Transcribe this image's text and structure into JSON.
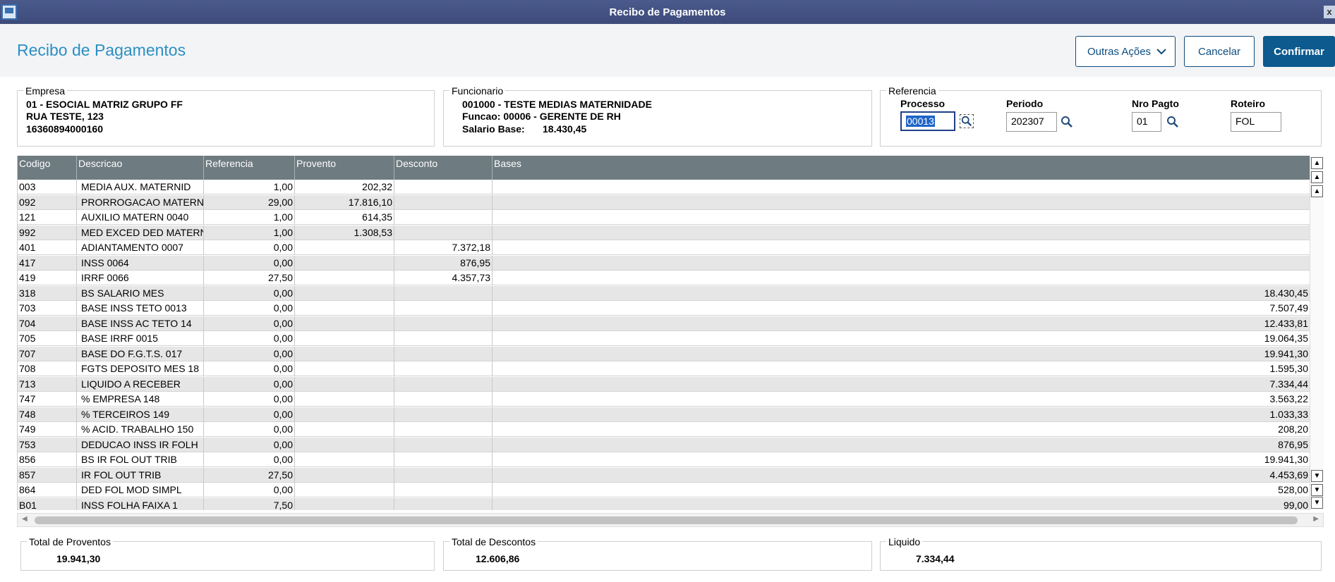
{
  "window": {
    "title": "Recibo de Pagamentos",
    "close": "x"
  },
  "header": {
    "title": "Recibo de Pagamentos",
    "outras_acoes": "Outras Ações",
    "cancelar": "Cancelar",
    "confirmar": "Confirmar"
  },
  "empresa": {
    "legend": "Empresa",
    "line1": "01 - ESOCIAL MATRIZ GRUPO FF",
    "line2": "RUA TESTE, 123",
    "line3": "16360894000160"
  },
  "funcionario": {
    "legend": "Funcionario",
    "line1": "001000 - TESTE MEDIAS MATERNIDADE",
    "line2": "Funcao: 00006 - GERENTE DE RH",
    "salario_label": "Salario Base:",
    "salario_value": "18.430,45"
  },
  "referencia": {
    "legend": "Referencia",
    "processo_label": "Processo",
    "processo_value": "00013",
    "periodo_label": "Periodo",
    "periodo_value": "202307",
    "nro_label": "Nro Pagto",
    "nro_value": "01",
    "roteiro_label": "Roteiro",
    "roteiro_value": "FOL"
  },
  "grid": {
    "columns": [
      "Codigo",
      "Descricao",
      "Referencia",
      "Provento",
      "Desconto",
      "Bases"
    ],
    "rows": [
      {
        "codigo": "003",
        "descricao": "MEDIA AUX. MATERNID",
        "referencia": "1,00",
        "provento": "202,32",
        "desconto": "",
        "bases": ""
      },
      {
        "codigo": "092",
        "descricao": "PRORROGACAO MATERN",
        "referencia": "29,00",
        "provento": "17.816,10",
        "desconto": "",
        "bases": ""
      },
      {
        "codigo": "121",
        "descricao": "AUXILIO MATERN 0040",
        "referencia": "1,00",
        "provento": "614,35",
        "desconto": "",
        "bases": ""
      },
      {
        "codigo": "992",
        "descricao": "MED EXCED DED MATERN",
        "referencia": "1,00",
        "provento": "1.308,53",
        "desconto": "",
        "bases": ""
      },
      {
        "codigo": "401",
        "descricao": "ADIANTAMENTO 0007",
        "referencia": "0,00",
        "provento": "",
        "desconto": "7.372,18",
        "bases": ""
      },
      {
        "codigo": "417",
        "descricao": "INSS 0064",
        "referencia": "0,00",
        "provento": "",
        "desconto": "876,95",
        "bases": ""
      },
      {
        "codigo": "419",
        "descricao": "IRRF 0066",
        "referencia": "27,50",
        "provento": "",
        "desconto": "4.357,73",
        "bases": ""
      },
      {
        "codigo": "318",
        "descricao": "BS SALARIO MES",
        "referencia": "0,00",
        "provento": "",
        "desconto": "",
        "bases": "18.430,45"
      },
      {
        "codigo": "703",
        "descricao": "BASE INSS TETO 0013",
        "referencia": "0,00",
        "provento": "",
        "desconto": "",
        "bases": "7.507,49"
      },
      {
        "codigo": "704",
        "descricao": "BASE INSS AC TETO 14",
        "referencia": "0,00",
        "provento": "",
        "desconto": "",
        "bases": "12.433,81"
      },
      {
        "codigo": "705",
        "descricao": "BASE IRRF 0015",
        "referencia": "0,00",
        "provento": "",
        "desconto": "",
        "bases": "19.064,35"
      },
      {
        "codigo": "707",
        "descricao": "BASE DO F.G.T.S. 017",
        "referencia": "0,00",
        "provento": "",
        "desconto": "",
        "bases": "19.941,30"
      },
      {
        "codigo": "708",
        "descricao": "FGTS DEPOSITO MES 18",
        "referencia": "0,00",
        "provento": "",
        "desconto": "",
        "bases": "1.595,30"
      },
      {
        "codigo": "713",
        "descricao": "LIQUIDO A RECEBER",
        "referencia": "0,00",
        "provento": "",
        "desconto": "",
        "bases": "7.334,44"
      },
      {
        "codigo": "747",
        "descricao": "% EMPRESA  148",
        "referencia": "0,00",
        "provento": "",
        "desconto": "",
        "bases": "3.563,22"
      },
      {
        "codigo": "748",
        "descricao": "% TERCEIROS 149",
        "referencia": "0,00",
        "provento": "",
        "desconto": "",
        "bases": "1.033,33"
      },
      {
        "codigo": "749",
        "descricao": "% ACID. TRABALHO 150",
        "referencia": "0,00",
        "provento": "",
        "desconto": "",
        "bases": "208,20"
      },
      {
        "codigo": "753",
        "descricao": "DEDUCAO INSS IR FOLH",
        "referencia": "0,00",
        "provento": "",
        "desconto": "",
        "bases": "876,95"
      },
      {
        "codigo": "856",
        "descricao": "BS IR FOL OUT TRIB",
        "referencia": "0,00",
        "provento": "",
        "desconto": "",
        "bases": "19.941,30"
      },
      {
        "codigo": "857",
        "descricao": "IR FOL OUT TRIB",
        "referencia": "27,50",
        "provento": "",
        "desconto": "",
        "bases": "4.453,69"
      },
      {
        "codigo": "864",
        "descricao": "DED FOL MOD SIMPL",
        "referencia": "0,00",
        "provento": "",
        "desconto": "",
        "bases": "528,00"
      },
      {
        "codigo": "B01",
        "descricao": "INSS FOLHA FAIXA 1",
        "referencia": "7,50",
        "provento": "",
        "desconto": "",
        "bases": "99,00"
      }
    ]
  },
  "totals": {
    "proventos_label": "Total de Proventos",
    "proventos_value": "19.941,30",
    "descontos_label": "Total de Descontos",
    "descontos_value": "12.606,86",
    "liquido_label": "Liquido",
    "liquido_value": "7.334,44"
  },
  "icons": {
    "search": "search-icon",
    "chevron": "chevron-down-icon",
    "scroll": "scroll-arrow-icon"
  }
}
